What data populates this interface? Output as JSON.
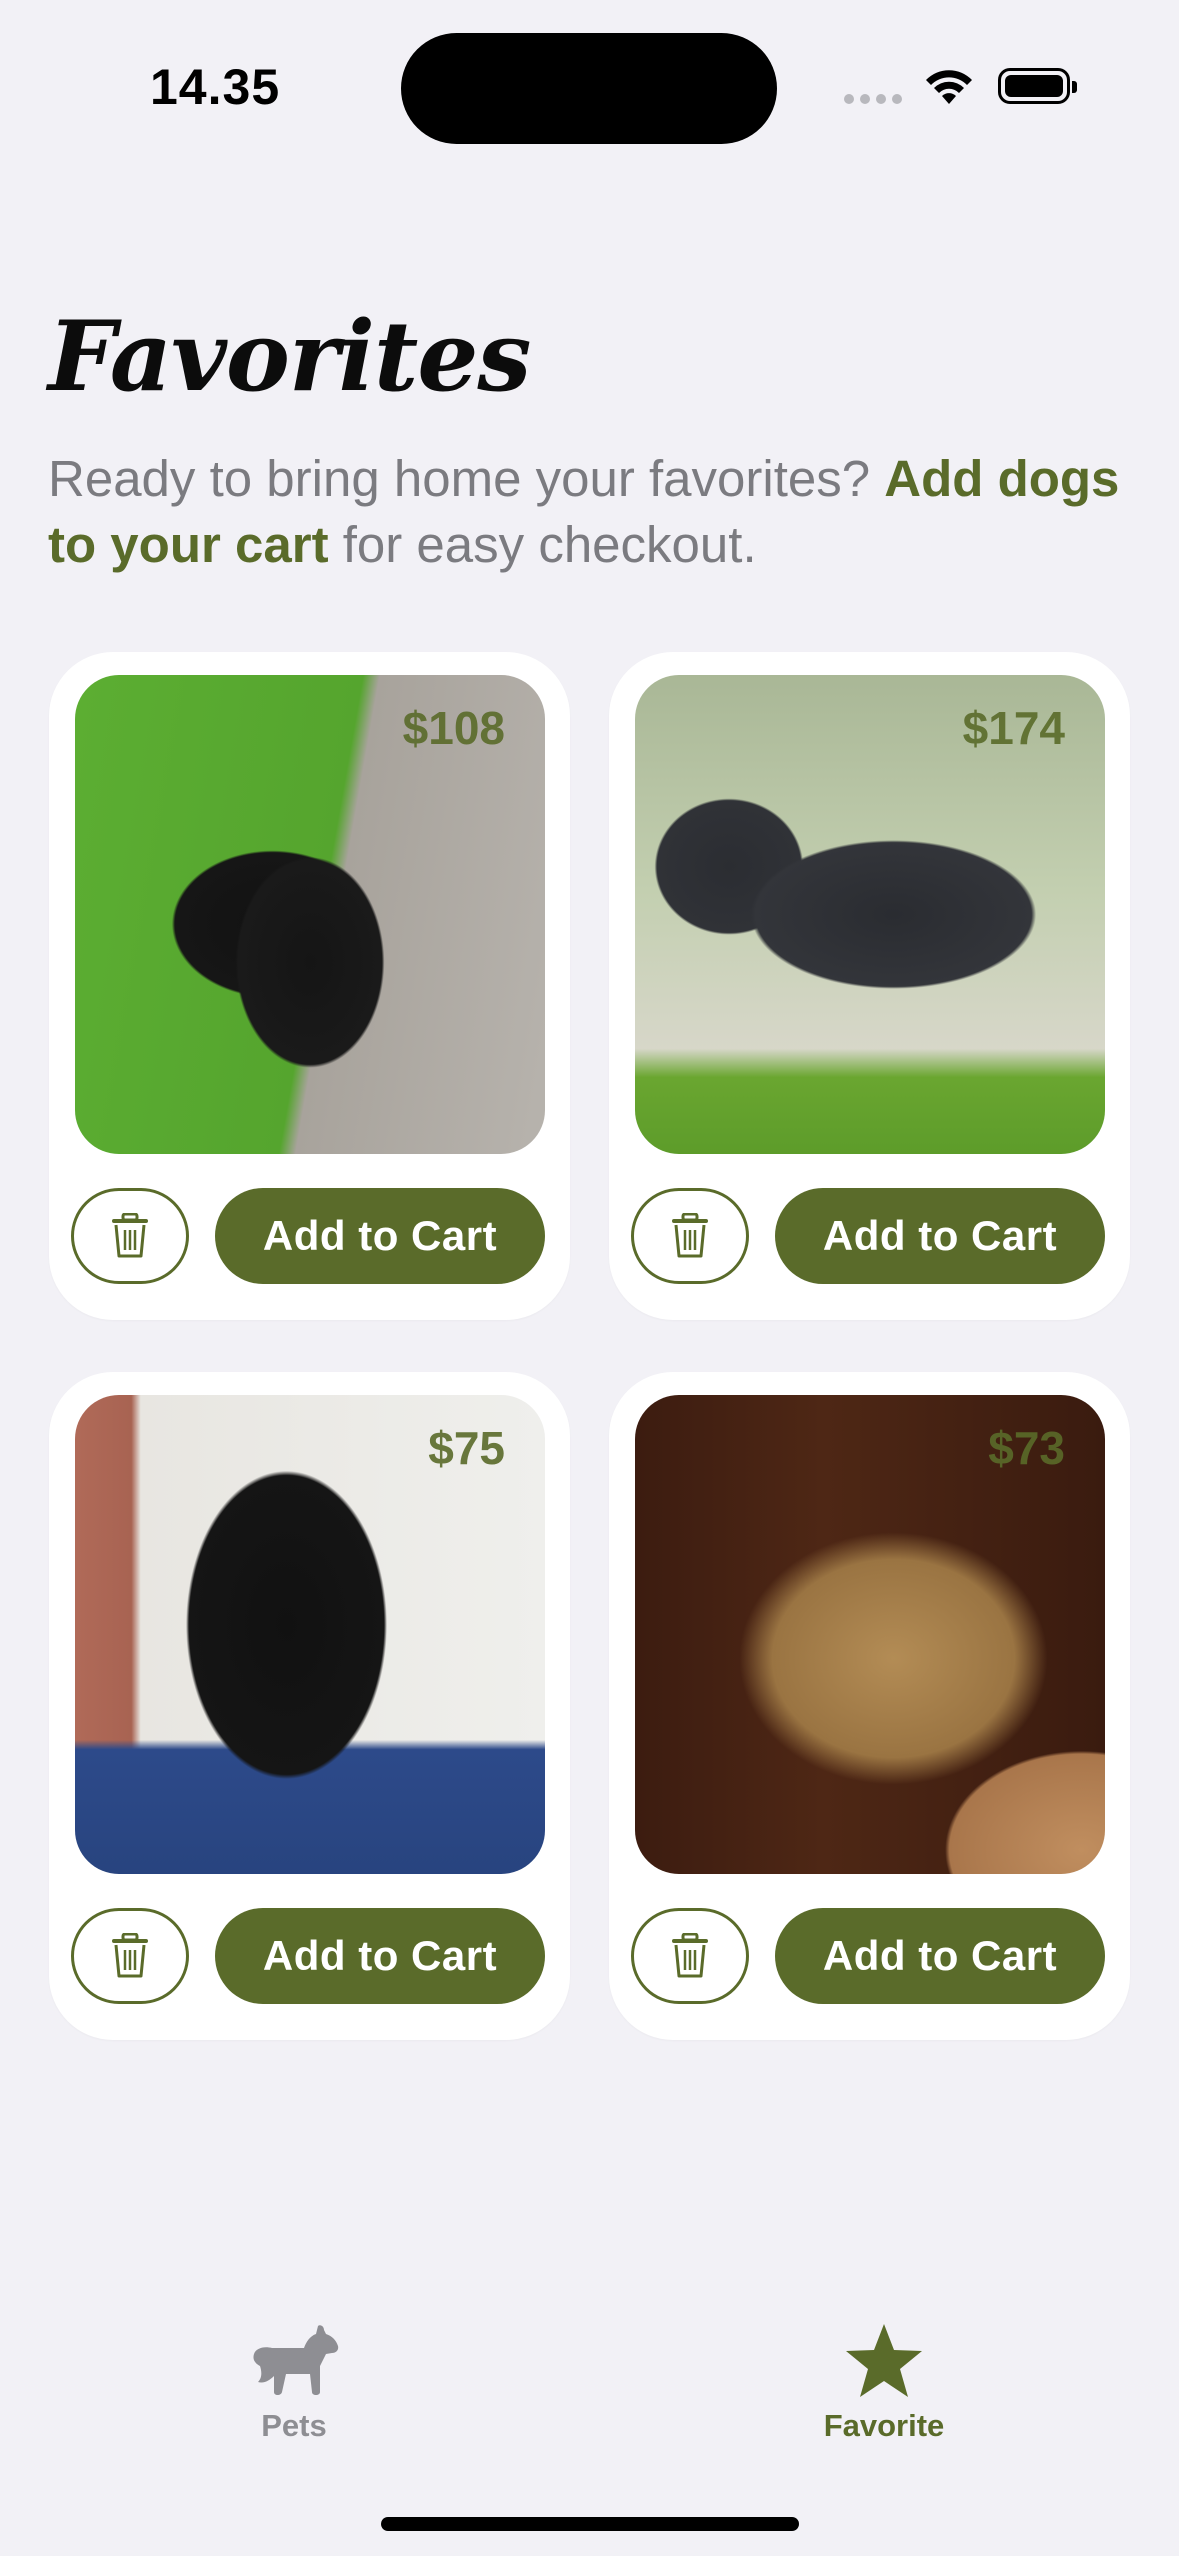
{
  "status_bar": {
    "time": "14.35"
  },
  "header": {
    "title": "Favorites",
    "subtitle_prefix": "Ready to bring home your favorites? ",
    "subtitle_accent": "Add dogs to your cart",
    "subtitle_suffix": " for easy checkout."
  },
  "favorites": [
    {
      "price": "$108",
      "add_label": "Add to Cart"
    },
    {
      "price": "$174",
      "add_label": "Add to Cart"
    },
    {
      "price": "$75",
      "add_label": "Add to Cart"
    },
    {
      "price": "$73",
      "add_label": "Add to Cart"
    }
  ],
  "tab_bar": {
    "tabs": [
      {
        "label": "Pets",
        "icon": "dog-icon",
        "selected": false
      },
      {
        "label": "Favorite",
        "icon": "star-icon",
        "selected": true
      }
    ]
  },
  "colors": {
    "accent": "#5a6b2a",
    "background": "#f2f1f6",
    "inactive": "#8e8e93"
  }
}
